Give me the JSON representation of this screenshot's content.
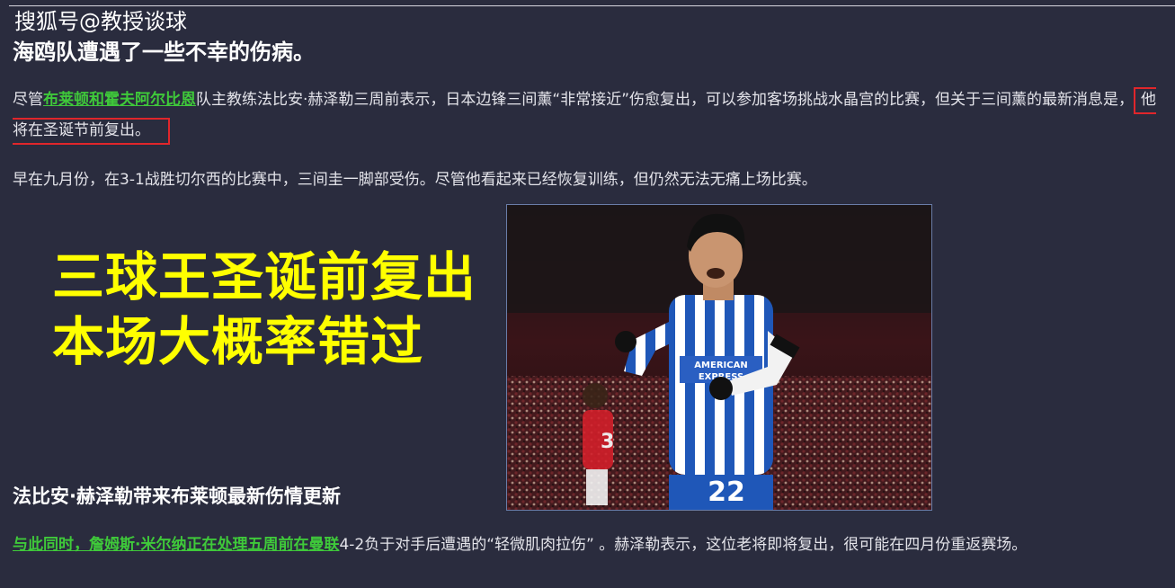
{
  "watermark": "搜狐号@教授谈球",
  "headline": "海鸥队遭遇了一些不幸的伤病。",
  "paragraph1": {
    "prefix": "尽管",
    "link": "布莱顿和霍夫阿尔比恩",
    "middle": "队主教练法比安·赫泽勒三周前表示，日本边锋三间薰“非常接近”伤愈复出，可以参加客场挑战水晶宫的比赛，但关于三间薰的最新消息是，",
    "highlight": "他将在圣诞节前复出。"
  },
  "paragraph2": "早在九月份，在3-1战胜切尔西的比赛中，三间圭一脚部受伤。尽管他看起来已经恢复训练，但仍然无法无痛上场比赛。",
  "overlay": {
    "line1": "三球王圣诞前复出",
    "line2": "本场大概率错过"
  },
  "photo": {
    "sponsor_line1": "AMERICAN",
    "sponsor_line2": "EXPRESS",
    "shirt_number": "22",
    "opponent_number": "3"
  },
  "subheading": "法比安·赫泽勒带来布莱顿最新伤情更新",
  "paragraph3": {
    "link": "与此同时，詹姆斯·米尔纳正在处理五周前在曼联",
    "rest": "4-2负于对手后遭遇的“轻微肌肉拉伤” 。赫泽勒表示，这位老将即将复出，很可能在四月份重返赛场。"
  },
  "colors": {
    "background": "#2a2c3e",
    "link": "#3fc93a",
    "overlay_text": "#ffff00",
    "highlight_border": "#e0262b"
  }
}
